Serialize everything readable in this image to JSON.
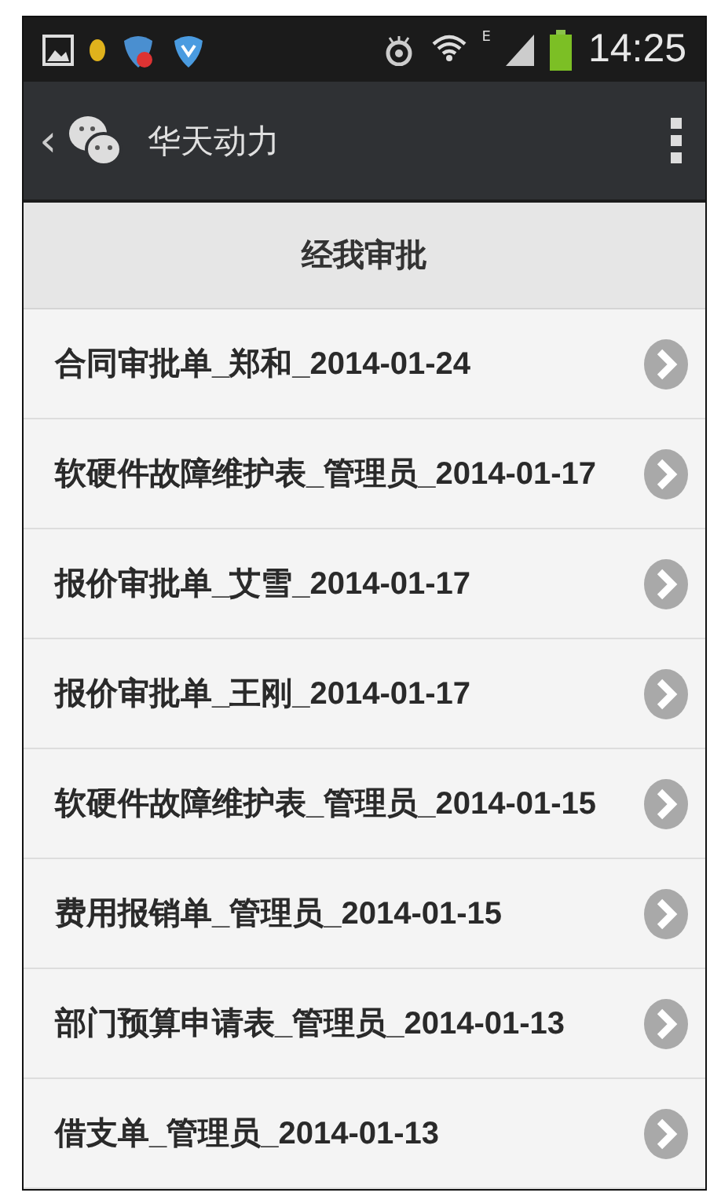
{
  "status_bar": {
    "network": "E",
    "time": "14:25"
  },
  "app_bar": {
    "back": "‹",
    "title": "华天动力"
  },
  "header": {
    "title": "经我审批"
  },
  "items": [
    {
      "label": "合同审批单_郑和_2014-01-24"
    },
    {
      "label": "软硬件故障维护表_管理员_2014-01-17"
    },
    {
      "label": "报价审批单_艾雪_2014-01-17"
    },
    {
      "label": "报价审批单_王刚_2014-01-17"
    },
    {
      "label": "软硬件故障维护表_管理员_2014-01-15"
    },
    {
      "label": "费用报销单_管理员_2014-01-15"
    },
    {
      "label": "部门预算申请表_管理员_2014-01-13"
    },
    {
      "label": "借支单_管理员_2014-01-13"
    }
  ]
}
